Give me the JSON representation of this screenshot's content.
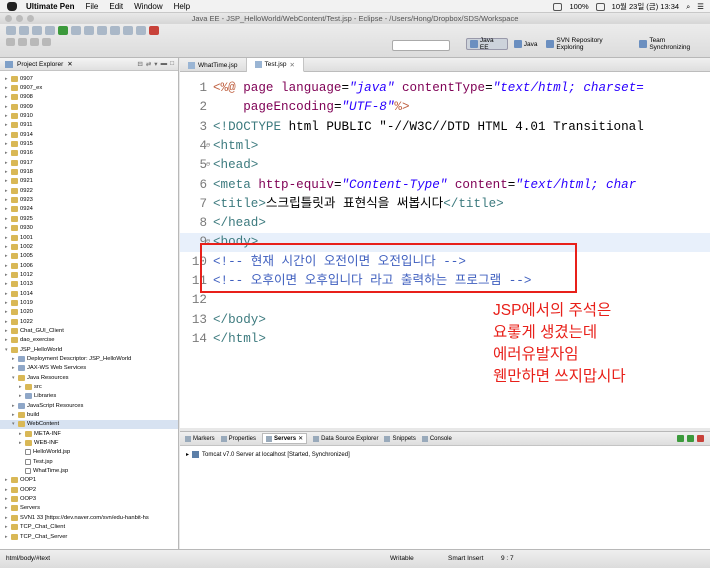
{
  "os_menu": {
    "app": "Ultimate Pen",
    "items": [
      "File",
      "Edit",
      "Window",
      "Help"
    ],
    "battery": "100%",
    "datetime": "10월 23일 (금) 13:34"
  },
  "window": {
    "title": "Java EE - JSP_HelloWorld/WebContent/Test.jsp - Eclipse - /Users/Hong/Dropbox/SDS/Workspace"
  },
  "toolbar": {
    "perspectives": [
      "Java EE",
      "Java",
      "SVN Repository Exploring",
      "Team Synchronizing"
    ]
  },
  "explorer": {
    "tab_label": "Project Explorer",
    "nodes": [
      {
        "label": "0907",
        "depth": 0,
        "kind": "folder"
      },
      {
        "label": "0907_ex",
        "depth": 0,
        "kind": "folder"
      },
      {
        "label": "0908",
        "depth": 0,
        "kind": "folder"
      },
      {
        "label": "0909",
        "depth": 0,
        "kind": "folder"
      },
      {
        "label": "0910",
        "depth": 0,
        "kind": "folder"
      },
      {
        "label": "0911",
        "depth": 0,
        "kind": "folder"
      },
      {
        "label": "0914",
        "depth": 0,
        "kind": "folder"
      },
      {
        "label": "0915",
        "depth": 0,
        "kind": "folder"
      },
      {
        "label": "0916",
        "depth": 0,
        "kind": "folder"
      },
      {
        "label": "0917",
        "depth": 0,
        "kind": "folder"
      },
      {
        "label": "0918",
        "depth": 0,
        "kind": "folder"
      },
      {
        "label": "0921",
        "depth": 0,
        "kind": "folder"
      },
      {
        "label": "0922",
        "depth": 0,
        "kind": "folder"
      },
      {
        "label": "0923",
        "depth": 0,
        "kind": "folder"
      },
      {
        "label": "0924",
        "depth": 0,
        "kind": "folder"
      },
      {
        "label": "0925",
        "depth": 0,
        "kind": "folder"
      },
      {
        "label": "0930",
        "depth": 0,
        "kind": "folder"
      },
      {
        "label": "1001",
        "depth": 0,
        "kind": "folder"
      },
      {
        "label": "1002",
        "depth": 0,
        "kind": "folder"
      },
      {
        "label": "1005",
        "depth": 0,
        "kind": "folder"
      },
      {
        "label": "1006",
        "depth": 0,
        "kind": "folder"
      },
      {
        "label": "1012",
        "depth": 0,
        "kind": "folder"
      },
      {
        "label": "1013",
        "depth": 0,
        "kind": "folder"
      },
      {
        "label": "1014",
        "depth": 0,
        "kind": "folder"
      },
      {
        "label": "1019",
        "depth": 0,
        "kind": "folder"
      },
      {
        "label": "1020",
        "depth": 0,
        "kind": "folder"
      },
      {
        "label": "1022",
        "depth": 0,
        "kind": "folder"
      },
      {
        "label": "Chat_GUI_Client",
        "depth": 0,
        "kind": "folder"
      },
      {
        "label": "dao_exercise",
        "depth": 0,
        "kind": "folder"
      },
      {
        "label": "JSP_HelloWorld",
        "depth": 0,
        "kind": "folder",
        "open": true
      },
      {
        "label": "Deployment Descriptor: JSP_HelloWorld",
        "depth": 1,
        "kind": "pkg"
      },
      {
        "label": "JAX-WS Web Services",
        "depth": 1,
        "kind": "pkg"
      },
      {
        "label": "Java Resources",
        "depth": 1,
        "kind": "folder",
        "open": true
      },
      {
        "label": "src",
        "depth": 2,
        "kind": "folder"
      },
      {
        "label": "Libraries",
        "depth": 2,
        "kind": "pkg"
      },
      {
        "label": "JavaScript Resources",
        "depth": 1,
        "kind": "pkg"
      },
      {
        "label": "build",
        "depth": 1,
        "kind": "folder"
      },
      {
        "label": "WebContent",
        "depth": 1,
        "kind": "folder",
        "open": true,
        "selected": true
      },
      {
        "label": "META-INF",
        "depth": 2,
        "kind": "folder"
      },
      {
        "label": "WEB-INF",
        "depth": 2,
        "kind": "folder"
      },
      {
        "label": "HelloWorld.jsp",
        "depth": 2,
        "kind": "file"
      },
      {
        "label": "Test.jsp",
        "depth": 2,
        "kind": "file"
      },
      {
        "label": "WhatTime.jsp",
        "depth": 2,
        "kind": "file"
      },
      {
        "label": "OOP1",
        "depth": 0,
        "kind": "folder"
      },
      {
        "label": "OOP2",
        "depth": 0,
        "kind": "folder"
      },
      {
        "label": "OOP3",
        "depth": 0,
        "kind": "folder"
      },
      {
        "label": "Servers",
        "depth": 0,
        "kind": "folder"
      },
      {
        "label": "SVN1 33 [https://dev.naver.com/svn/edu-hanbit-hs",
        "depth": 0,
        "kind": "folder"
      },
      {
        "label": "TCP_Chat_Client",
        "depth": 0,
        "kind": "folder"
      },
      {
        "label": "TCP_Chat_Server",
        "depth": 0,
        "kind": "folder"
      }
    ]
  },
  "editor": {
    "tabs": [
      {
        "label": "WhatTime.jsp",
        "active": false
      },
      {
        "label": "Test.jsp",
        "active": true
      }
    ],
    "lines": [
      {
        "n": "1",
        "fold": "",
        "hl": false,
        "parts": [
          [
            "dir",
            "<%@ "
          ],
          [
            "attr",
            "page "
          ],
          [
            "attr",
            "language"
          ],
          [
            "",
            "="
          ],
          [
            "val",
            "\"java\""
          ],
          [
            "",
            " "
          ],
          [
            "attr",
            "contentType"
          ],
          [
            "",
            "="
          ],
          [
            "val",
            "\"text/html; charset="
          ]
        ]
      },
      {
        "n": "2",
        "fold": "",
        "hl": false,
        "parts": [
          [
            "",
            "    "
          ],
          [
            "attr",
            "pageEncoding"
          ],
          [
            "",
            "="
          ],
          [
            "val",
            "\"UTF-8\""
          ],
          [
            "dir",
            "%>"
          ]
        ]
      },
      {
        "n": "3",
        "fold": "",
        "hl": false,
        "parts": [
          [
            "tag",
            "<!DOCTYPE "
          ],
          [
            "",
            "html PUBLIC \"-//W3C//DTD HTML 4.01 Transitional"
          ]
        ]
      },
      {
        "n": "4",
        "fold": "⊖",
        "hl": false,
        "parts": [
          [
            "tag",
            "<html>"
          ]
        ]
      },
      {
        "n": "5",
        "fold": "⊖",
        "hl": false,
        "parts": [
          [
            "tag",
            "<head>"
          ]
        ]
      },
      {
        "n": "6",
        "fold": "",
        "hl": false,
        "parts": [
          [
            "tag",
            "<meta "
          ],
          [
            "attr",
            "http-equiv"
          ],
          [
            "",
            "="
          ],
          [
            "val",
            "\"Content-Type\""
          ],
          [
            "",
            " "
          ],
          [
            "attr",
            "content"
          ],
          [
            "",
            "="
          ],
          [
            "val",
            "\"text/html; char"
          ]
        ]
      },
      {
        "n": "7",
        "fold": "",
        "hl": false,
        "parts": [
          [
            "tag",
            "<title>"
          ],
          [
            "",
            "스크립틀릿과 표현식을 써봅시다"
          ],
          [
            "tag",
            "</title>"
          ]
        ]
      },
      {
        "n": "8",
        "fold": "",
        "hl": false,
        "parts": [
          [
            "tag",
            "</head>"
          ]
        ]
      },
      {
        "n": "9",
        "fold": "⊖",
        "hl": true,
        "parts": [
          [
            "tag",
            "<body>"
          ]
        ]
      },
      {
        "n": "10",
        "fold": "",
        "hl": false,
        "parts": [
          [
            "cm",
            "<!-- 현재 시간이 오전이면 오전입니다 -->"
          ]
        ]
      },
      {
        "n": "11",
        "fold": "",
        "hl": false,
        "parts": [
          [
            "cm",
            "<!-- 오후이면 오후입니다 라고 출력하는 프로그램 -->"
          ]
        ]
      },
      {
        "n": "12",
        "fold": "",
        "hl": false,
        "parts": [
          [
            "",
            ""
          ]
        ]
      },
      {
        "n": "13",
        "fold": "",
        "hl": false,
        "parts": [
          [
            "tag",
            "</body>"
          ]
        ]
      },
      {
        "n": "14",
        "fold": "",
        "hl": false,
        "parts": [
          [
            "tag",
            "</html>"
          ]
        ]
      }
    ]
  },
  "annotation": {
    "lines": [
      "JSP에서의 주석은",
      "요롷게 생겼는데",
      "에러유발자임",
      "웬만하면 쓰지맙시다"
    ],
    "color": "#e8201a"
  },
  "bottom_panel": {
    "tabs": [
      {
        "label": "Markers",
        "active": false
      },
      {
        "label": "Properties",
        "active": false
      },
      {
        "label": "Servers",
        "active": true
      },
      {
        "label": "Data Source Explorer",
        "active": false
      },
      {
        "label": "Snippets",
        "active": false
      },
      {
        "label": "Console",
        "active": false
      }
    ],
    "server_entry": "Tomcat v7.0 Server at localhost  [Started, Synchronized]"
  },
  "status_bar": {
    "path": "html/body/#text",
    "mode": "Writable",
    "insert": "Smart Insert",
    "position": "9 : 7"
  }
}
